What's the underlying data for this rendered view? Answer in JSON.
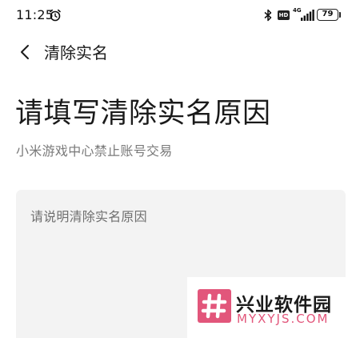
{
  "status_bar": {
    "time": "11:25",
    "network_type": "4G",
    "hd_badge": "HD",
    "battery_level": "79"
  },
  "header": {
    "title": "清除实名"
  },
  "main": {
    "title": "请填写清除实名原因",
    "subtitle": "小米游戏中心禁止账号交易",
    "reason_placeholder": "请说明清除实名原因"
  },
  "watermark": {
    "name": "兴业软件园",
    "domain": "MYXYJS.COM"
  },
  "colors": {
    "watermark_accent": "#e2567b",
    "input_background": "#f3f3f3",
    "subtitle_text": "#7a7a7a"
  }
}
